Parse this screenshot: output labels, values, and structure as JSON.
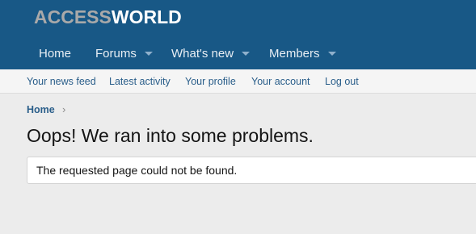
{
  "brand": {
    "logo_part1": "ACCESS",
    "logo_part2": "WORLD"
  },
  "nav": [
    {
      "label": "Home",
      "has_menu": false
    },
    {
      "label": "Forums",
      "has_menu": true
    },
    {
      "label": "What's new",
      "has_menu": true
    },
    {
      "label": "Members",
      "has_menu": true
    }
  ],
  "subnav": [
    {
      "label": "Your news feed"
    },
    {
      "label": "Latest activity"
    },
    {
      "label": "Your profile"
    },
    {
      "label": "Your account"
    },
    {
      "label": "Log out"
    }
  ],
  "breadcrumb": {
    "home": "Home",
    "separator": "›"
  },
  "page": {
    "title": "Oops! We ran into some problems.",
    "message": "The requested page could not be found."
  },
  "colors": {
    "header_bg": "#185886",
    "page_bg": "#ececec",
    "link": "#2a5e8a"
  },
  "icons": {
    "menu_caret": "chevron-down-icon",
    "breadcrumb_separator": "chevron-right-icon"
  }
}
